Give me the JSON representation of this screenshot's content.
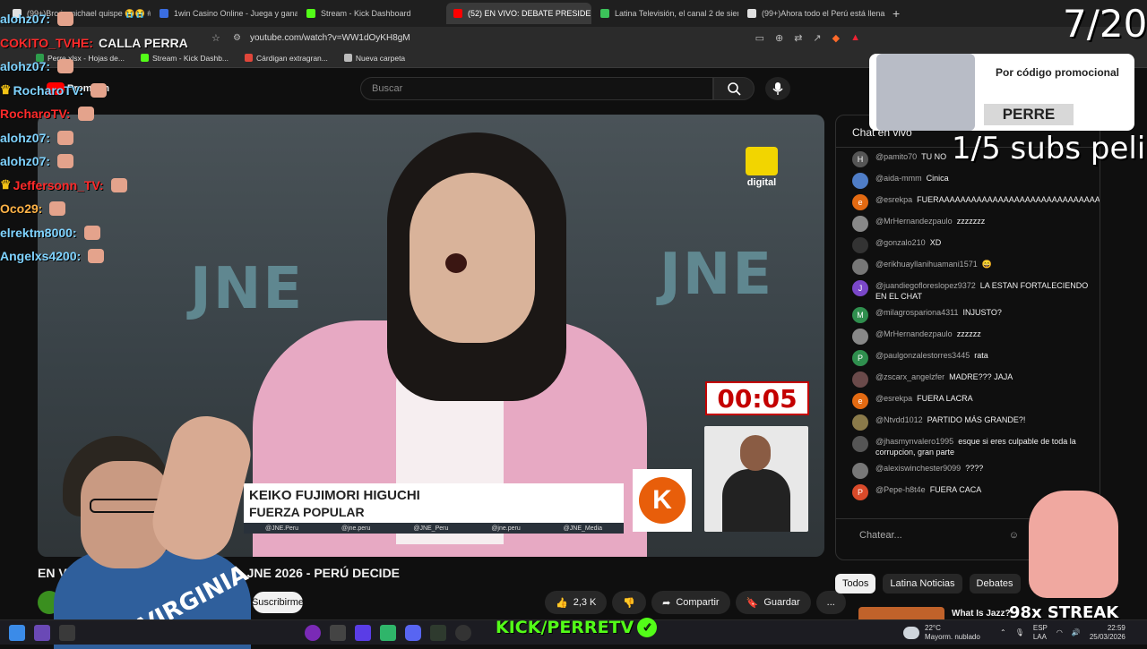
{
  "browser": {
    "tabs": [
      {
        "title": "(99+)Bro is michael quispe 😭😭 #c",
        "color": "#e0e0e0",
        "active": false
      },
      {
        "title": "1win Casino Online - Juega y gana h",
        "color": "#3a6de0",
        "active": false
      },
      {
        "title": "Stream - Kick Dashboard",
        "color": "#53fc18",
        "active": false
      },
      {
        "title": "(52) EN VIVO: DEBATE PRESIDE",
        "color": "#ff0000",
        "active": true
      },
      {
        "title": "Latina Televisión, el canal 2 de siemp",
        "color": "#3cc35a",
        "active": false
      },
      {
        "title": "(99+)Ahora todo el Perú está llena de",
        "color": "#e0e0e0",
        "active": false
      }
    ],
    "new_tab": "+",
    "url": "youtube.com/watch?v=WW1dOyKH8gM",
    "bookmarks": [
      {
        "label": "Perre.xlsx - Hojas de...",
        "color": "#2e9d4c"
      },
      {
        "label": "Stream - Kick Dashb...",
        "color": "#53fc18"
      },
      {
        "label": "Cárdigan extragran...",
        "color": "#e0463a"
      },
      {
        "label": "Nueva carpeta",
        "color": "#bbbbbb"
      }
    ]
  },
  "youtube": {
    "logo_text": "Premium",
    "search_placeholder": "Buscar",
    "video_title": "EN VIVO: DEBATE PRESIDENCIAL JNE 2026 - PERÚ DECIDE",
    "subscribe_label": "Suscribirme",
    "likes": "2,3 K",
    "share_label": "Compartir",
    "save_label": "Guardar",
    "more_label": "...",
    "chat_title": "Chat en vivo",
    "chat_input_placeholder": "Chatear...",
    "chips": [
      {
        "label": "Todos",
        "active": true
      },
      {
        "label": "Latina Noticias",
        "active": false
      },
      {
        "label": "Debates",
        "active": false
      }
    ],
    "rec_title": "What Is Jazz?"
  },
  "video": {
    "watermark": "JNE",
    "channel_logo_text": "digital",
    "timer": "00:05",
    "lower_third_name": "KEIKO FUJIMORI HIGUCHI",
    "lower_third_party": "FUERZA POPULAR",
    "socials": [
      "@JNE.Peru",
      "@jne.peru",
      "@JNE_Peru",
      "@jne.peru",
      "@JNE_Media"
    ],
    "k_logo": "K"
  },
  "chat_messages": [
    {
      "user": "@pamito70",
      "text": "TU NO",
      "av": "H",
      "color": "#555555"
    },
    {
      "user": "@aida-mmm",
      "text": "Cinica",
      "av": "",
      "color": "#4f7dc7"
    },
    {
      "user": "@esrekpa",
      "text": "FUERAAAAAAAAAAAAAAAAAAAAAAAAAAAAAAAAAAAA",
      "av": "e",
      "color": "#e36a12"
    },
    {
      "user": "@MrHernandezpaulo",
      "text": "zzzzzzz",
      "av": "",
      "color": "#888888"
    },
    {
      "user": "@gonzalo210",
      "text": "XD",
      "av": "",
      "color": "#333333"
    },
    {
      "user": "@erikhuayllanihuamani1571",
      "text": "😄",
      "av": "",
      "color": "#777777"
    },
    {
      "user": "@juandiegofloreslopez9372",
      "text": "LA ESTAN FORTALECIENDO EN EL CHAT",
      "av": "J",
      "color": "#7a47c9"
    },
    {
      "user": "@milagrospariona4311",
      "text": "INJUSTO?",
      "av": "M",
      "color": "#2f8f4e"
    },
    {
      "user": "@MrHernandezpaulo",
      "text": "zzzzzz",
      "av": "",
      "color": "#888888"
    },
    {
      "user": "@paulgonzalestorres3445",
      "text": "rata",
      "av": "P",
      "color": "#2f8f4e"
    },
    {
      "user": "@zscarx_angelzfer",
      "text": "MADRE??? JAJA",
      "av": "",
      "color": "#6a4a4a"
    },
    {
      "user": "@esrekpa",
      "text": "FUERA LACRA",
      "av": "e",
      "color": "#e36a12"
    },
    {
      "user": "@Ntvdd1012",
      "text": "PARTIDO MÁS GRANDE?!",
      "av": "",
      "color": "#8a7a4a"
    },
    {
      "user": "@jhasmynvalero1995",
      "text": "esque si eres culpable de toda la corrupcion, gran parte",
      "av": "",
      "color": "#555555"
    },
    {
      "user": "@alexiswinchester9099",
      "text": "????",
      "av": "",
      "color": "#777777"
    },
    {
      "user": "@Pepe-h8t4e",
      "text": "FUERA CACA",
      "av": "P",
      "color": "#d94a2a"
    }
  ],
  "stream_overlay": {
    "chat_lines": [
      {
        "user": "alohz07:",
        "color": "#7fd3ff",
        "crown": false
      },
      {
        "user": "COKITO_TVHE:",
        "color": "#ff2a2a",
        "text": "CALLA PERRA",
        "crown": false
      },
      {
        "user": "alohz07:",
        "color": "#7fd3ff",
        "crown": false
      },
      {
        "user": "RocharoTV:",
        "color": "#7fd3ff",
        "crown": true
      },
      {
        "user": "RocharoTV:",
        "color": "#ff2a2a",
        "crown": false
      },
      {
        "user": "alohz07:",
        "color": "#7fd3ff",
        "crown": false
      },
      {
        "user": "alohz07:",
        "color": "#7fd3ff",
        "crown": false
      },
      {
        "user": "Jeffersonn_TV:",
        "color": "#ff2a2a",
        "crown": true
      },
      {
        "user": "Oco29:",
        "color": "#ffb347",
        "crown": false
      },
      {
        "user": "elrektm8000:",
        "color": "#7fd3ff",
        "crown": false
      },
      {
        "user": "Angelxs4200:",
        "color": "#7fd3ff",
        "crown": false
      }
    ],
    "counter": "7/20",
    "promo_label": "Por código promocional",
    "promo_code": "PERRE",
    "subs_goal": "1/5 subs peli",
    "streak": "98x STREAK",
    "kick_brand": "KICK/PERRETV",
    "shirt_text": "VIRGINIA"
  },
  "taskbar": {
    "weather_temp": "22°C",
    "weather_desc": "Mayorm. nublado",
    "lang": "ESP",
    "lang2": "LAA",
    "time": "22:59",
    "date": "25/03/2026"
  }
}
